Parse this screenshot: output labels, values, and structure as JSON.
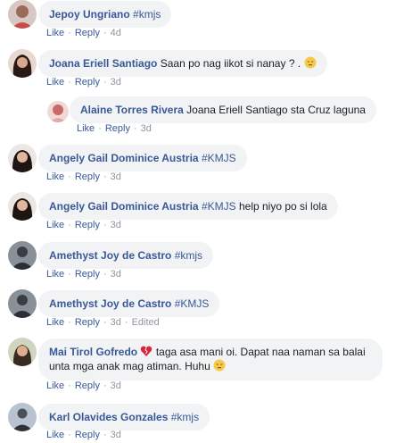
{
  "comments": [
    {
      "name": "Jepoy Ungriano",
      "tag": "#kmjs",
      "text": "",
      "like": "Like",
      "reply": "Reply",
      "time": "4d",
      "edited": ""
    },
    {
      "name": "Joana Eriell Santiago",
      "tag": "",
      "text": "Saan po nag iikot si nanay ? .",
      "like": "Like",
      "reply": "Reply",
      "time": "3d",
      "edited": ""
    },
    {
      "name": "Alaine Torres Rivera",
      "tag": "",
      "text": "Joana Eriell Santiago sta Cruz laguna",
      "like": "Like",
      "reply": "Reply",
      "time": "3d",
      "edited": ""
    },
    {
      "name": "Angely Gail Dominice Austria",
      "tag": "#KMJS",
      "text": "",
      "like": "Like",
      "reply": "Reply",
      "time": "3d",
      "edited": ""
    },
    {
      "name": "Angely Gail Dominice Austria",
      "tag": "#KMJS",
      "text": "help niyo po si lola",
      "like": "Like",
      "reply": "Reply",
      "time": "3d",
      "edited": ""
    },
    {
      "name": "Amethyst Joy de Castro",
      "tag": "#kmjs",
      "text": "",
      "like": "Like",
      "reply": "Reply",
      "time": "3d",
      "edited": ""
    },
    {
      "name": "Amethyst Joy de Castro",
      "tag": "#KMJS",
      "text": "",
      "like": "Like",
      "reply": "Reply",
      "time": "3d",
      "edited": "Edited"
    },
    {
      "name": "Mai Tirol Gofredo",
      "tag": "",
      "text": "taga asa mani oi. Dapat naa naman sa balai unta mga anak mag atiman. Huhu",
      "like": "Like",
      "reply": "Reply",
      "time": "3d",
      "edited": ""
    },
    {
      "name": "Karl Olavides Gonzales",
      "tag": "#kmjs",
      "text": "",
      "like": "Like",
      "reply": "Reply",
      "time": "3d",
      "edited": ""
    }
  ],
  "separator": "·",
  "colors": {
    "name": "#385898",
    "bubble": "#f2f3f5",
    "meta": "#90949c"
  }
}
